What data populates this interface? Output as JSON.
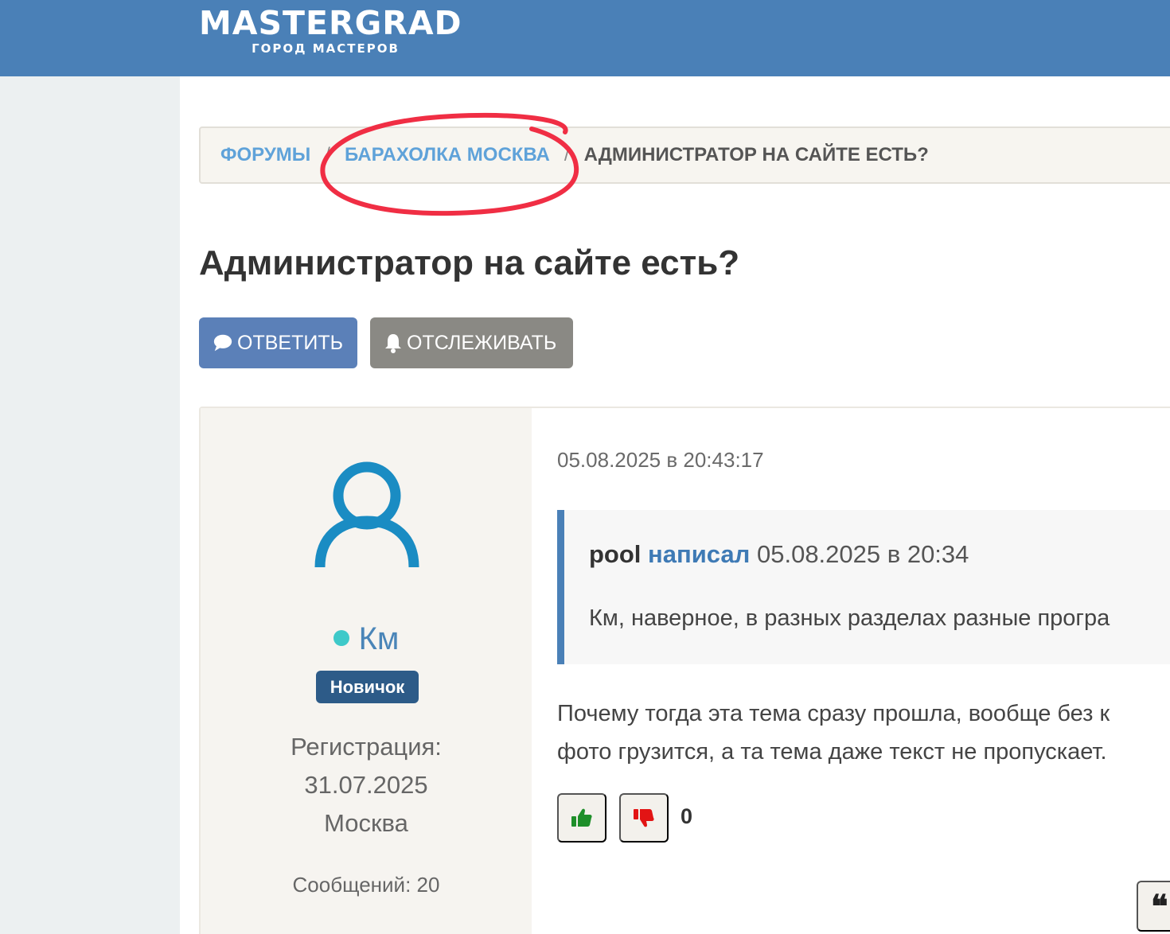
{
  "header": {
    "logo_main": "MASTERGRAD",
    "logo_sub": "ГОРОД МАСТЕРОВ",
    "background_color": "#4a80b7"
  },
  "breadcrumb": {
    "items": [
      "Форумы",
      "Барахолка Москва",
      "Администратор на сайте есть?"
    ],
    "separator": "/"
  },
  "page_title": "Администратор на сайте есть?",
  "actions": {
    "reply_label": "Ответить",
    "reply_icon": "speech-bubble-icon",
    "watch_label": "Отслеживать",
    "watch_icon": "bell-icon"
  },
  "post": {
    "author": {
      "name": "Км",
      "online": true,
      "rank": "Новичок",
      "registration_label": "Регистрация:",
      "registration_date": "31.07.2025",
      "city": "Москва",
      "messages_label": "Сообщений: 20"
    },
    "date": "05.08.2025 в 20:43:17",
    "quote": {
      "author": "pool",
      "wrote": "написал",
      "date": "05.08.2025 в 20:34",
      "text": "Км, наверное, в разных разделах разные програ"
    },
    "text_lines": [
      "Почему тогда эта тема сразу прошла, вообще без к",
      "фото грузится, а та тема даже текст не пропускает."
    ],
    "votes": {
      "count": "0",
      "up_icon": "thumbs-up-icon",
      "down_icon": "thumbs-down-icon"
    },
    "quote_button_glyph": "❝"
  },
  "colors": {
    "accent": "#4a80b7",
    "reply_button": "#5b80b8",
    "watch_button": "#8a8984",
    "rank_badge": "#2d5b88",
    "online_dot": "#3ec9c9",
    "annotation_circle": "#f02e44"
  }
}
